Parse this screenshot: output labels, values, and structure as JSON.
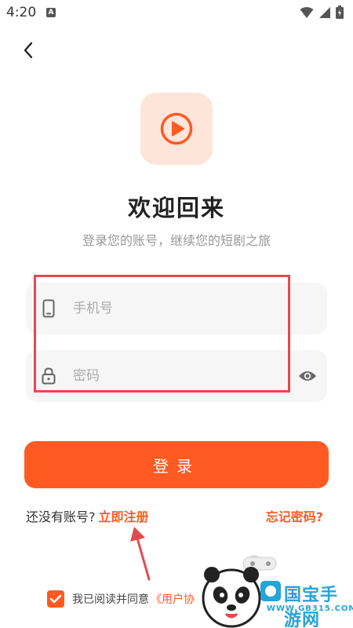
{
  "status": {
    "time": "4:20",
    "app_badge": "A"
  },
  "header": {
    "back_icon": "chevron-left-icon"
  },
  "logo": {
    "icon": "play-circle-icon",
    "bg_color": "#fde5da",
    "accent": "#ff5a22"
  },
  "welcome": {
    "title": "欢迎回来",
    "subtitle": "登录您的账号，继续您的短剧之旅"
  },
  "form": {
    "phone_placeholder": "手机号",
    "phone_value": "",
    "password_placeholder": "密码",
    "password_value": ""
  },
  "login": {
    "label": "登录"
  },
  "register": {
    "prompt": "还没有账号?",
    "link": "立即注册"
  },
  "forgot": {
    "label": "忘记密码?"
  },
  "agreement": {
    "checked": true,
    "text": "我已阅读并同意",
    "link": "《用户协"
  },
  "watermark": {
    "logo_text": "国宝手游网",
    "url": "WWW.GB315.COM"
  }
}
